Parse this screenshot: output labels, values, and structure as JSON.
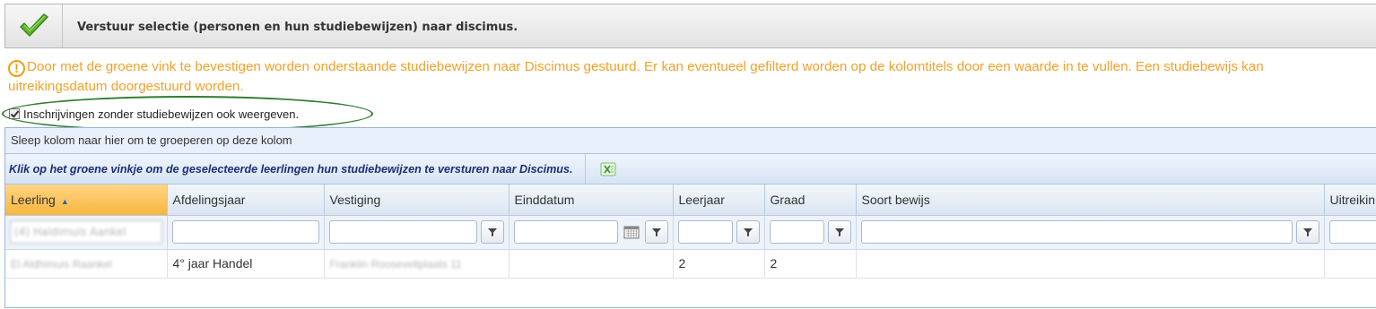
{
  "toolbar": {
    "confirm_icon": "green-checkmark-icon",
    "title": "Verstuur selectie (personen en hun studiebewijzen) naar discimus."
  },
  "notice": {
    "icon": "exclamation-circle-icon",
    "line1": "Door met de groene vink te bevestigen worden onderstaande studiebewijzen naar Discimus gestuurd. Er kan eventueel gefilterd worden op de kolomtitels door een waarde in te vullen. Een studiebewijs kan",
    "line2": "uitreikingsdatum doorgestuurd worden.",
    "color": "#f3a12b"
  },
  "show_without_certificates": {
    "label": "Inschrijvingen zonder studiebewijzen ook weergeven.",
    "checked": true
  },
  "grid": {
    "group_panel_text": "Sleep kolom naar hier om te groeperen op deze kolom",
    "command_text": "Klik op het groene vinkje om de geselecteerde leerlingen hun studiebewijzen te versturen naar Discimus.",
    "export_icon": "excel-export-icon",
    "columns": [
      "Leerling",
      "Afdelingsjaar",
      "Vestiging",
      "Einddatum",
      "Leerjaar",
      "Graad",
      "Soort bewijs",
      "Uitreikin"
    ],
    "sorted_column": "Leerling",
    "sort_direction": "ascending",
    "filter_leerling_value": "(4) Haldimuis Aankel",
    "rows": [
      {
        "leerling": "El Aldhimuis Raankel",
        "afdelingsjaar": "4° jaar Handel",
        "vestiging": "Franklin Rooseveltplaats 11",
        "einddatum": "",
        "leerjaar": "2",
        "graad": "2",
        "soort_bewijs": "",
        "uitreiking": ""
      }
    ]
  }
}
